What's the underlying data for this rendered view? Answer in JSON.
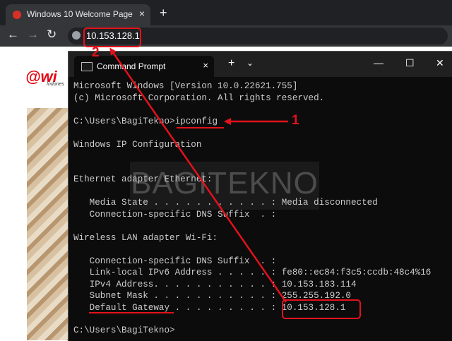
{
  "browser": {
    "tab_title": "Windows 10 Welcome Page",
    "tab_close_icon": "×",
    "new_tab_icon": "+",
    "back_icon": "←",
    "forward_icon": "→",
    "reload_icon": "↻",
    "url": "10.153.128.1"
  },
  "webpage": {
    "logo_mark": "@wi",
    "logo_subtext": "Indones"
  },
  "cmd": {
    "tab_title": "Command Prompt",
    "close_icon": "×",
    "new_tab_icon": "+",
    "dropdown_icon": "⌄",
    "minimize_icon": "—",
    "maximize_icon": "☐",
    "window_close_icon": "✕",
    "lines": {
      "l1": "Microsoft Windows [Version 10.0.22621.755]",
      "l2": "(c) Microsoft Corporation. All rights reserved.",
      "l3": "C:\\Users\\BagiTekno>ipconfig",
      "l4": "Windows IP Configuration",
      "l5": "Ethernet adapter Ethernet:",
      "l6": "   Media State . . . . . . . . . . . : Media disconnected",
      "l7": "   Connection-specific DNS Suffix  . :",
      "l8": "Wireless LAN adapter Wi-Fi:",
      "l9": "   Connection-specific DNS Suffix  . :",
      "l10": "   Link-local IPv6 Address . . . . . : fe80::ec84:f3c5:ccdb:48c4%16",
      "l11": "   IPv4 Address. . . . . . . . . . . : 10.153.183.114",
      "l12": "   Subnet Mask . . . . . . . . . . . : 255.255.192.0",
      "l13": "   Default Gateway . . . . . . . . . : 10.153.128.1",
      "l14": "C:\\Users\\BagiTekno>"
    }
  },
  "watermark": "BAGITEKNO",
  "annotations": {
    "step1": "1",
    "step2": "2",
    "color": "#e3121b"
  }
}
